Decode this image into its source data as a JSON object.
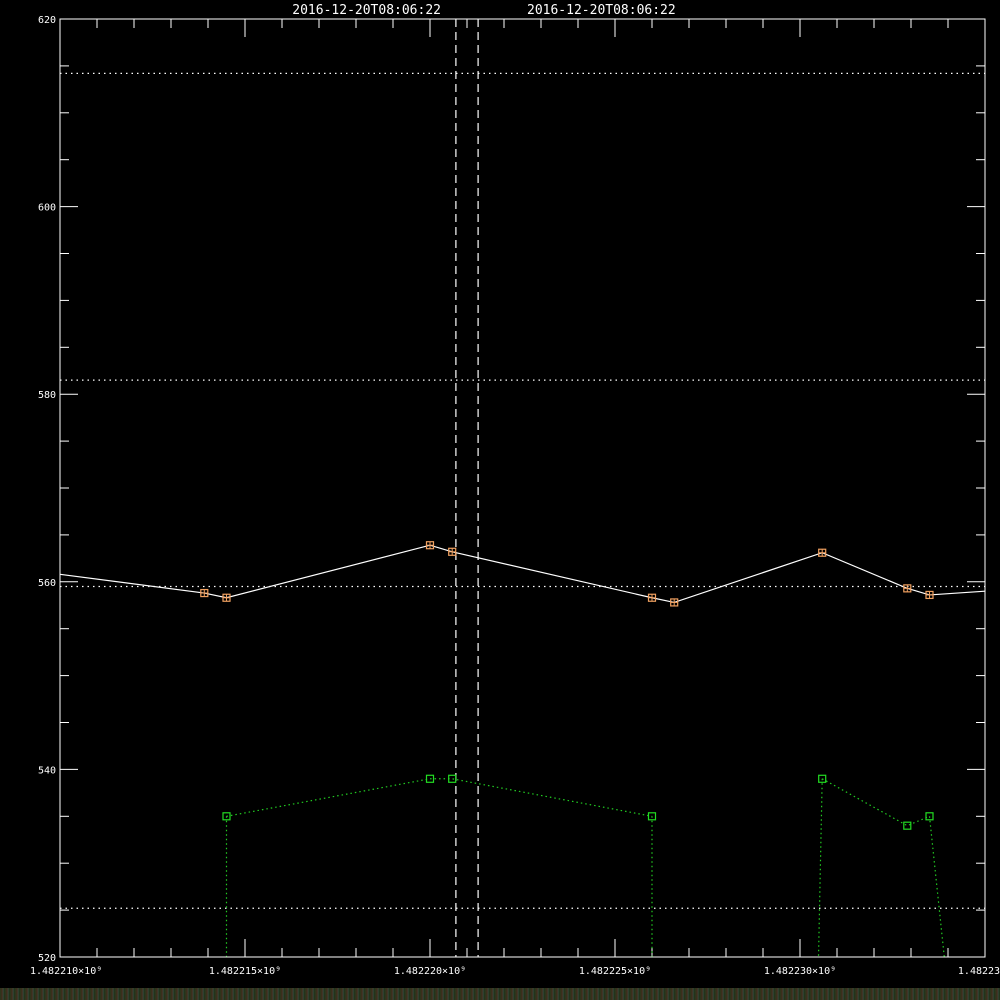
{
  "chart_data": {
    "type": "line",
    "title_left": "2016-12-20T08:06:22",
    "title_right": "2016-12-20T08:06:22",
    "xlabel": "",
    "ylabel": "",
    "xlim": [
      1482210000,
      1482235000
    ],
    "ylim": [
      520,
      620
    ],
    "x_tick_labels": [
      {
        "value": 1482210000,
        "label": "1.482210×10⁹"
      },
      {
        "value": 1482215000,
        "label": "1.482215×10⁹"
      },
      {
        "value": 1482220000,
        "label": "1.482220×10⁹"
      },
      {
        "value": 1482225000,
        "label": "1.482225×10⁹"
      },
      {
        "value": 1482230000,
        "label": "1.482230×10⁹"
      },
      {
        "value": 1482235000,
        "label": "1.482235×"
      }
    ],
    "y_tick_labels": [
      {
        "value": 520,
        "label": "520"
      },
      {
        "value": 540,
        "label": "540"
      },
      {
        "value": 560,
        "label": "560"
      },
      {
        "value": 580,
        "label": "580"
      },
      {
        "value": 600,
        "label": "600"
      },
      {
        "value": 620,
        "label": "620"
      }
    ],
    "y_minor_step": 5,
    "x_minor_step": 1000,
    "reference_lines_y": [
      614.2,
      581.5,
      559.5,
      525.2
    ],
    "marker_lines_x": [
      1482220700,
      1482221300
    ],
    "series": [
      {
        "color": "#ffffff",
        "marker_color": "#f0a060",
        "style": "solid",
        "x": [
          1482210000,
          1482213900,
          1482214500,
          1482220000,
          1482220600,
          1482226000,
          1482226600,
          1482230600,
          1482232900,
          1482233500,
          1482235000
        ],
        "y": [
          560.8,
          558.8,
          558.3,
          563.9,
          563.2,
          558.3,
          557.8,
          563.1,
          559.3,
          558.6,
          559.0
        ]
      },
      {
        "color": "#22cc22",
        "marker_color": "#22dd22",
        "style": "dotted",
        "x": [
          1482214500,
          1482220000,
          1482220600,
          1482226000,
          1482230600,
          1482232900,
          1482233500
        ],
        "y": [
          535,
          539,
          539,
          535,
          539,
          534,
          535
        ],
        "drop_lines": [
          {
            "from_index": 0,
            "to_x": 1482214500,
            "to_y": 520
          },
          {
            "from_index": 3,
            "to_x": 1482226000,
            "to_y": 520
          },
          {
            "from_index": 4,
            "to_x": 1482230500,
            "to_y": 520
          },
          {
            "from_index": 6,
            "to_x": 1482233900,
            "to_y": 520
          }
        ],
        "break_after_index": [
          3
        ]
      }
    ]
  }
}
